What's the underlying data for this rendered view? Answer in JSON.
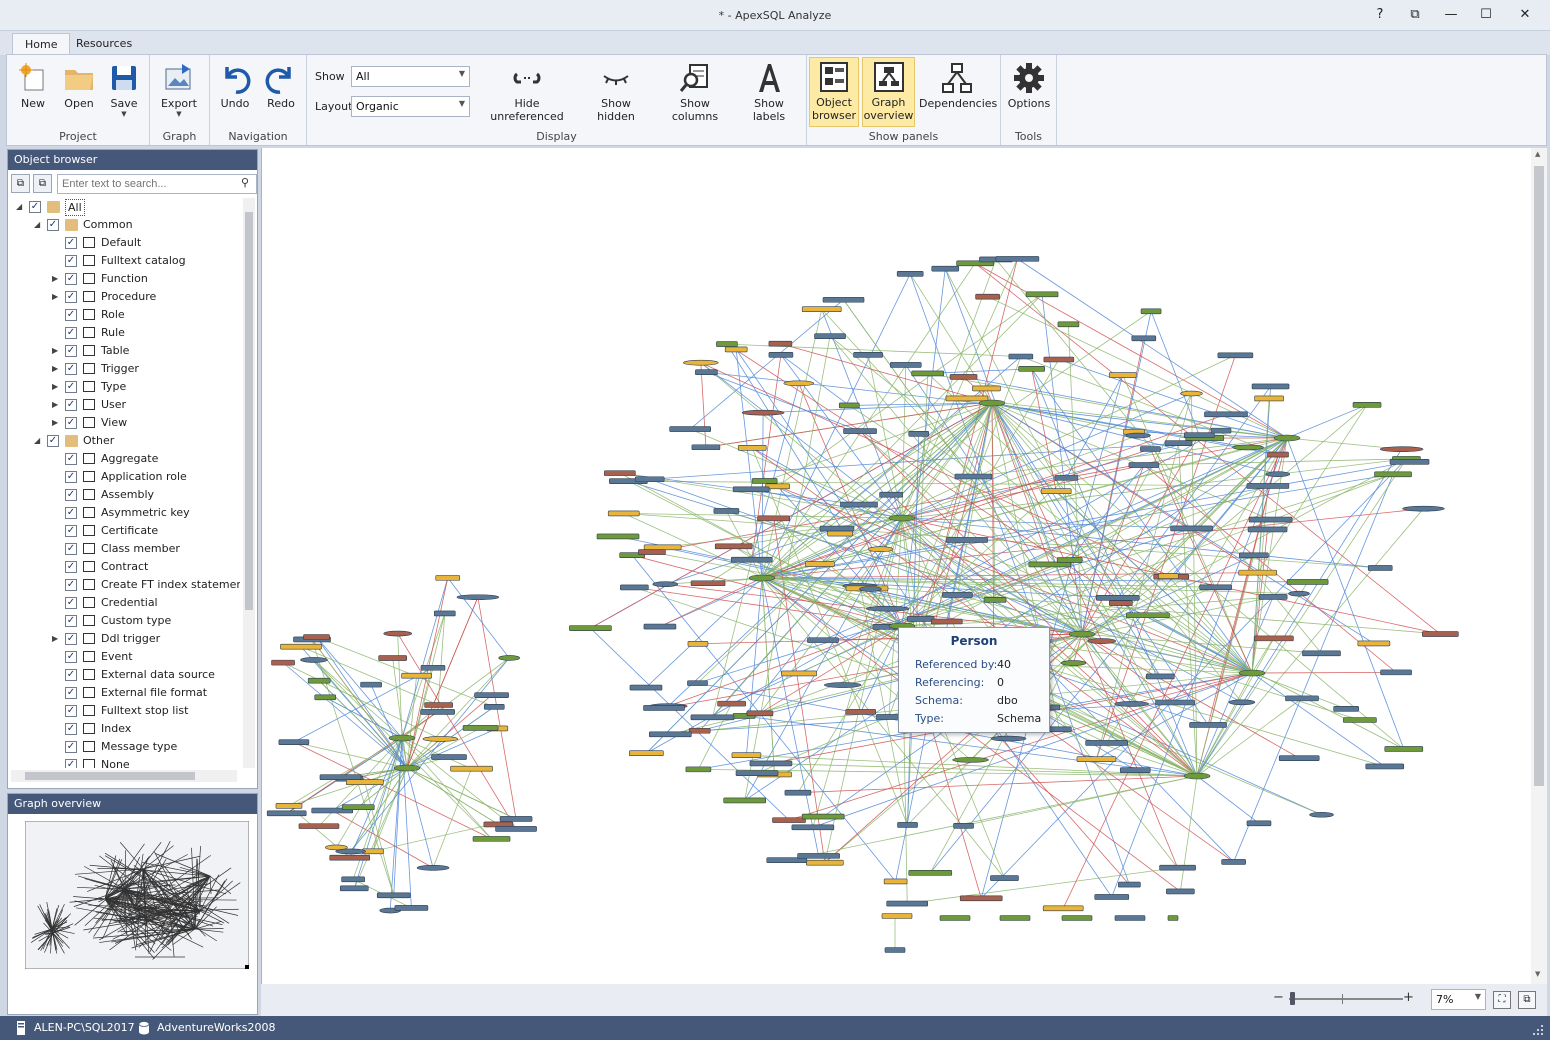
{
  "window": {
    "title": "* - ApexSQL Analyze",
    "help": "?",
    "restore": "⧉",
    "minimize": "—",
    "maximize": "☐",
    "close": "✕"
  },
  "tabs": [
    {
      "label": "Home"
    },
    {
      "label": "Resources"
    }
  ],
  "ribbon": {
    "project": {
      "title": "Project",
      "new": "New",
      "open": "Open",
      "save": "Save"
    },
    "graph": {
      "title": "Graph",
      "export": "Export"
    },
    "navigation": {
      "title": "Navigation",
      "undo": "Undo",
      "redo": "Redo"
    },
    "display": {
      "title": "Display",
      "show_label": "Show",
      "show_value": "All",
      "layout_label": "Layout",
      "layout_value": "Organic",
      "hide_unreferenced": "Hide unreferenced",
      "show_hidden": "Show hidden",
      "show_columns": "Show columns",
      "show_labels": "Show labels"
    },
    "panels": {
      "title": "Show panels",
      "object_browser_1": "Object",
      "object_browser_2": "browser",
      "graph_overview_1": "Graph",
      "graph_overview_2": "overview",
      "dependencies": "Dependencies"
    },
    "tools": {
      "title": "Tools",
      "options": "Options"
    }
  },
  "object_browser": {
    "title": "Object browser",
    "search_placeholder": "Enter text to search...",
    "tree": [
      {
        "label": "All",
        "level": 0,
        "expander": "open",
        "icon": "folder"
      },
      {
        "label": "Common",
        "level": 1,
        "expander": "open",
        "icon": "folder"
      },
      {
        "label": "Default",
        "level": 2,
        "expander": "",
        "icon": "default"
      },
      {
        "label": "Fulltext catalog",
        "level": 2,
        "expander": "",
        "icon": "catalog"
      },
      {
        "label": "Function",
        "level": 2,
        "expander": "closed",
        "icon": "function"
      },
      {
        "label": "Procedure",
        "level": 2,
        "expander": "closed",
        "icon": "procedure"
      },
      {
        "label": "Role",
        "level": 2,
        "expander": "",
        "icon": "role"
      },
      {
        "label": "Rule",
        "level": 2,
        "expander": "",
        "icon": "rule"
      },
      {
        "label": "Table",
        "level": 2,
        "expander": "closed",
        "icon": "table"
      },
      {
        "label": "Trigger",
        "level": 2,
        "expander": "closed",
        "icon": "trigger"
      },
      {
        "label": "Type",
        "level": 2,
        "expander": "closed",
        "icon": "type"
      },
      {
        "label": "User",
        "level": 2,
        "expander": "closed",
        "icon": "user"
      },
      {
        "label": "View",
        "level": 2,
        "expander": "closed",
        "icon": "view"
      },
      {
        "label": "Other",
        "level": 1,
        "expander": "open",
        "icon": "folder"
      },
      {
        "label": "Aggregate",
        "level": 2,
        "expander": "",
        "icon": "aggregate"
      },
      {
        "label": "Application role",
        "level": 2,
        "expander": "",
        "icon": "approle"
      },
      {
        "label": "Assembly",
        "level": 2,
        "expander": "",
        "icon": "assembly"
      },
      {
        "label": "Asymmetric key",
        "level": 2,
        "expander": "",
        "icon": "key"
      },
      {
        "label": "Certificate",
        "level": 2,
        "expander": "",
        "icon": "certificate"
      },
      {
        "label": "Class member",
        "level": 2,
        "expander": "",
        "icon": "classmember"
      },
      {
        "label": "Contract",
        "level": 2,
        "expander": "",
        "icon": "contract"
      },
      {
        "label": "Create FT index statement",
        "level": 2,
        "expander": "",
        "icon": "ftindex"
      },
      {
        "label": "Credential",
        "level": 2,
        "expander": "",
        "icon": "credential"
      },
      {
        "label": "Custom type",
        "level": 2,
        "expander": "",
        "icon": "customtype"
      },
      {
        "label": "Ddl trigger",
        "level": 2,
        "expander": "closed",
        "icon": "ddltrigger"
      },
      {
        "label": "Event",
        "level": 2,
        "expander": "",
        "icon": "event"
      },
      {
        "label": "External data source",
        "level": 2,
        "expander": "",
        "icon": "datasource"
      },
      {
        "label": "External file format",
        "level": 2,
        "expander": "",
        "icon": "fileformat"
      },
      {
        "label": "Fulltext stop list",
        "level": 2,
        "expander": "",
        "icon": "stoplist"
      },
      {
        "label": "Index",
        "level": 2,
        "expander": "",
        "icon": "index"
      },
      {
        "label": "Message type",
        "level": 2,
        "expander": "",
        "icon": "message"
      },
      {
        "label": "None",
        "level": 2,
        "expander": "",
        "icon": "none"
      }
    ]
  },
  "graph_overview": {
    "title": "Graph overview"
  },
  "tooltip": {
    "title": "Person",
    "rows": [
      {
        "key": "Referenced by:",
        "value": "40"
      },
      {
        "key": "Referencing:",
        "value": "0"
      },
      {
        "key": "Schema:",
        "value": "dbo"
      },
      {
        "key": "Type:",
        "value": "Schema"
      }
    ]
  },
  "zoom": {
    "value": "7%"
  },
  "status": {
    "server": "ALEN-PC\\SQL2017",
    "database": "AdventureWorks2008"
  },
  "colors": {
    "table": "#5a7896",
    "procedure": "#a8604f",
    "view": "#6e9a3c",
    "function": "#e8b43a",
    "edge_green": "#8ab56a",
    "edge_blue": "#4d86d8",
    "edge_red": "#d05050",
    "panel_header": "#46587a"
  }
}
